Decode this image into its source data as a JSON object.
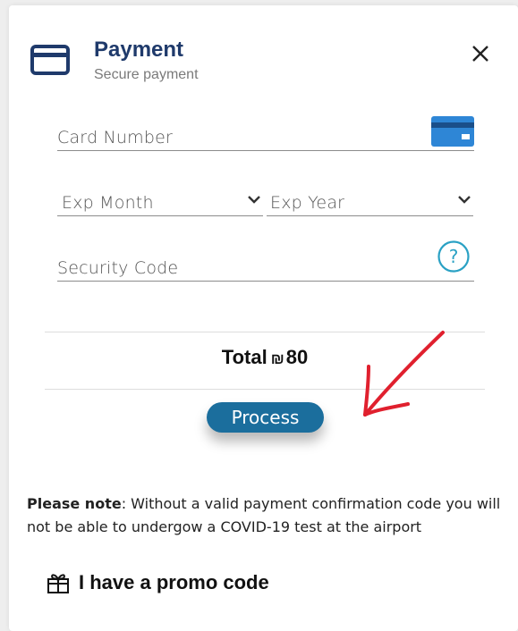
{
  "header": {
    "title": "Payment",
    "subtitle": "Secure payment",
    "icon": "credit-card-icon",
    "close_icon": "close-icon"
  },
  "form": {
    "card_number_label": "Card Number",
    "exp_month_label": "Exp Month",
    "exp_year_label": "Exp Year",
    "security_code_label": "Security Code",
    "help_icon": "question-circle-icon"
  },
  "summary": {
    "total_label": "Total",
    "currency_symbol": "₪",
    "amount": "80"
  },
  "actions": {
    "process_label": "Process"
  },
  "note": {
    "bold_prefix": "Please note",
    "text": ": Without a valid payment confirmation code you will not be able to undergow a COVID-19 test at the airport"
  },
  "promo": {
    "label": "I have a promo code",
    "icon": "gift-icon"
  },
  "colors": {
    "title": "#1f3a6b",
    "accent": "#1b6e9d",
    "card_icon_blue": "#2e86d6",
    "help_icon": "#2aa1c4",
    "annotation_arrow": "#e0202e"
  }
}
